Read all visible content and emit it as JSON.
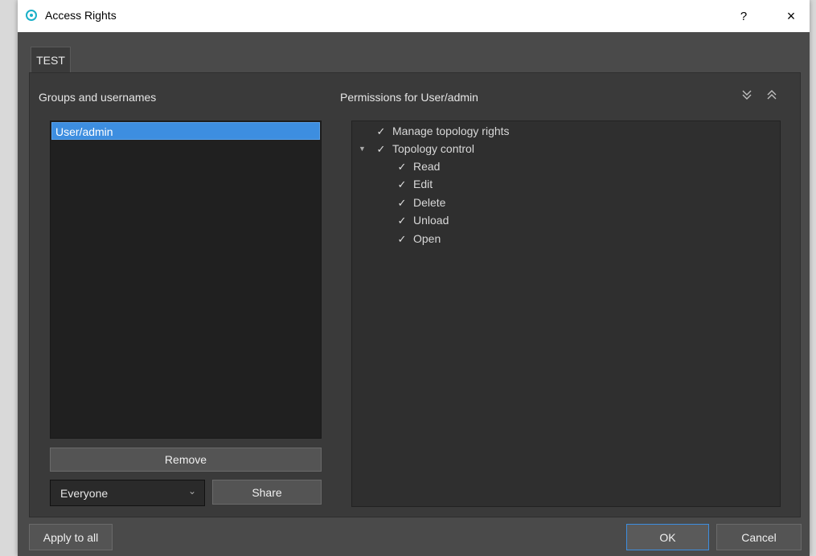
{
  "window": {
    "title": "Access Rights",
    "help_label": "?",
    "close_label": "×"
  },
  "tabs": [
    {
      "label": "TEST"
    }
  ],
  "left_panel": {
    "label": "Groups and usernames",
    "items": [
      {
        "label": "User/admin",
        "selected": true
      }
    ],
    "remove_label": "Remove",
    "group_select": {
      "value": "Everyone"
    },
    "share_label": "Share"
  },
  "right_panel": {
    "label": "Permissions for User/admin",
    "expand_icon": "expand-all-icon",
    "collapse_icon": "collapse-all-icon",
    "tree": {
      "manage": {
        "label": "Manage topology rights",
        "checked": true
      },
      "topology": {
        "label": "Topology control",
        "checked": true,
        "expanded": true,
        "children": [
          {
            "label": "Read",
            "checked": true
          },
          {
            "label": "Edit",
            "checked": true
          },
          {
            "label": "Delete",
            "checked": true
          },
          {
            "label": "Unload",
            "checked": true
          },
          {
            "label": "Open",
            "checked": true
          }
        ]
      }
    }
  },
  "footer": {
    "apply_label": "Apply to all",
    "ok_label": "OK",
    "cancel_label": "Cancel"
  },
  "colors": {
    "accent": "#3d8ee0",
    "background": "#4a4a4a",
    "panel": "#3a3a3a"
  }
}
